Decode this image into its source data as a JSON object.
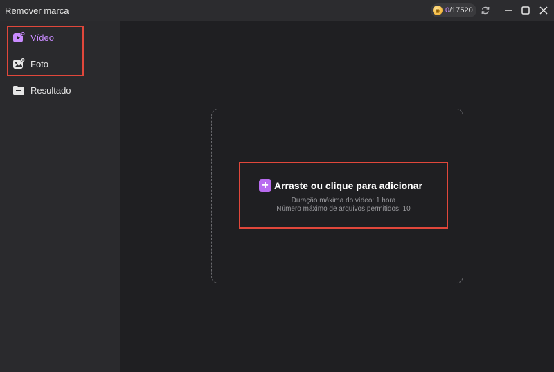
{
  "app": {
    "title": "Remover marca"
  },
  "credits": {
    "used": "0",
    "total": "/17520"
  },
  "sidebar": {
    "items": [
      {
        "label": "Vídeo",
        "icon": "video-add-icon",
        "active": true
      },
      {
        "label": "Foto",
        "icon": "photo-add-icon",
        "active": false
      },
      {
        "label": "Resultado",
        "icon": "folder-icon",
        "active": false
      }
    ]
  },
  "dropzone": {
    "add_label": "Arraste ou clique para adicionar",
    "max_duration": "Duração máxima do vídeo: 1 hora",
    "max_files": "Número máximo de arquivos permitidos: 10"
  },
  "colors": {
    "accent": "#c98bff",
    "plus_button": "#b96bf0",
    "highlight": "#e0473b",
    "background": "#1f1f22",
    "sidebar": "#2a2a2d"
  }
}
